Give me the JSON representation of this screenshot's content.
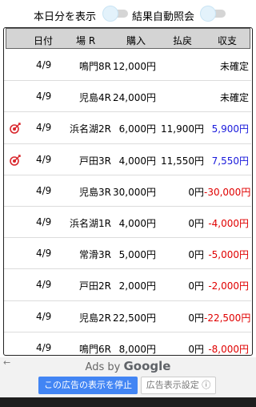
{
  "toggles": {
    "today_only_label": "本日分を表示",
    "auto_result_label": "結果自動照会"
  },
  "table": {
    "headers": {
      "date": "日付",
      "venue": "場 R",
      "buy": "購入",
      "payout": "払戻",
      "balance": "収支"
    },
    "rows": [
      {
        "date": "4/9",
        "venue": "鳴門8R",
        "buy": "12,000円",
        "payout": "",
        "balance": "未確定",
        "balance_type": "neutral",
        "hit": false
      },
      {
        "date": "4/9",
        "venue": "児島4R",
        "buy": "24,000円",
        "payout": "",
        "balance": "未確定",
        "balance_type": "neutral",
        "hit": false
      },
      {
        "date": "4/9",
        "venue": "浜名湖2R",
        "buy": "6,000円",
        "payout": "11,900円",
        "balance": "5,900円",
        "balance_type": "positive",
        "hit": true
      },
      {
        "date": "4/9",
        "venue": "戸田3R",
        "buy": "4,000円",
        "payout": "11,550円",
        "balance": "7,550円",
        "balance_type": "positive",
        "hit": true
      },
      {
        "date": "4/9",
        "venue": "児島3R",
        "buy": "30,000円",
        "payout": "0円",
        "balance": "-30,000円",
        "balance_type": "negative",
        "hit": false
      },
      {
        "date": "4/9",
        "venue": "浜名湖1R",
        "buy": "4,000円",
        "payout": "0円",
        "balance": "-4,000円",
        "balance_type": "negative",
        "hit": false
      },
      {
        "date": "4/9",
        "venue": "常滑3R",
        "buy": "5,000円",
        "payout": "0円",
        "balance": "-5,000円",
        "balance_type": "negative",
        "hit": false
      },
      {
        "date": "4/9",
        "venue": "戸田2R",
        "buy": "2,000円",
        "payout": "0円",
        "balance": "-2,000円",
        "balance_type": "negative",
        "hit": false
      },
      {
        "date": "4/9",
        "venue": "児島2R",
        "buy": "22,500円",
        "payout": "0円",
        "balance": "-22,500円",
        "balance_type": "negative",
        "hit": false
      },
      {
        "date": "4/9",
        "venue": "鳴門6R",
        "buy": "8,000円",
        "payout": "0円",
        "balance": "-8,000円",
        "balance_type": "negative",
        "hit": false
      }
    ]
  },
  "ads": {
    "ads_by": "Ads by",
    "google": "Google",
    "stop_label": "この広告の表示を停止",
    "settings_label": "広告表示設定 ⓘ",
    "back_arrow": "←"
  },
  "colors": {
    "negative": "#e00000",
    "positive": "#1a1adc",
    "hit_icon": "#d9262c",
    "button": "#4285f4"
  },
  "icons": {
    "hit": "target-dart-icon"
  }
}
